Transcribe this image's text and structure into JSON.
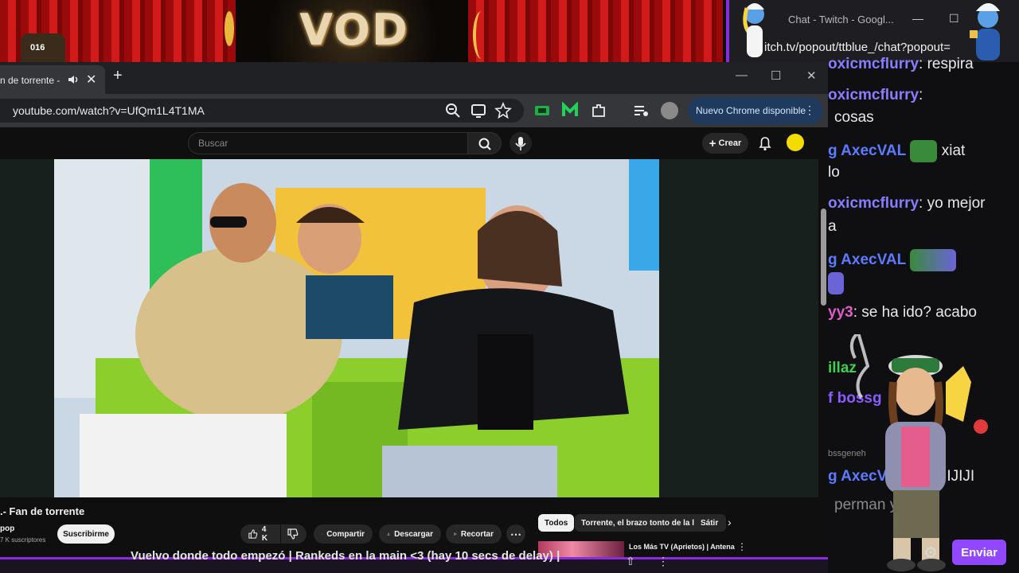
{
  "banner": {
    "title": "VOD",
    "counter": "016"
  },
  "chat_window": {
    "title": "Chat - Twitch - Googl...",
    "url": "itch.tv/popout/ttblue_/chat?popout=",
    "messages": [
      {
        "user": "oxicmcflurry",
        "text": ": respira",
        "color": "#8a7cff"
      },
      {
        "user": "oxicmcflurry",
        "text": ":",
        "color": "#8a7cff"
      },
      {
        "user": "",
        "text": "cosas",
        "color": "#e8e8ea"
      },
      {
        "user": "g AxecVAL",
        "text": "xiat",
        "color": "#5b7cff"
      },
      {
        "user": "",
        "text": "lo",
        "color": "#e8e8ea"
      },
      {
        "user": "oxicmcflurry",
        "text": ": yo mejor",
        "color": "#8a7cff"
      },
      {
        "user": "",
        "text": "a",
        "color": "#e8e8ea"
      },
      {
        "user": "g AxecVAL",
        "text": ":",
        "color": "#5b7cff"
      },
      {
        "user": "yy3",
        "text": ": se ha ido? acabo",
        "color": "#e05cc8"
      },
      {
        "user": "illaz",
        "text": "",
        "color": "#3fcf4a"
      },
      {
        "user": "f bossg",
        "text": "",
        "color": "#8a5cff"
      },
      {
        "user": "bssgeneh",
        "text": "",
        "color": "#888888"
      },
      {
        "user": "g AxecVA",
        "text": "JIJIJI",
        "color": "#5b7cff"
      }
    ],
    "input_text": "perman       y    ned",
    "send_label": "Enviar"
  },
  "browser": {
    "tab_title": "n de torrente -",
    "url": "youtube.com/watch?v=UfQm1L4T1MA",
    "update_label": "Nuevo Chrome disponible"
  },
  "youtube": {
    "search_placeholder": "Buscar",
    "create_label": "Crear",
    "video_title": ".- Fan de torrente",
    "channel": "pop",
    "subscribers": "7 K suscriptores",
    "subscribe_label": "Suscribirme",
    "likes": "4 K",
    "share_label": "Compartir",
    "download_label": "Descargar",
    "clip_label": "Recortar",
    "chips": [
      "Todos",
      "Torrente, el brazo tonto de la ley",
      "Sátir"
    ],
    "rec_title": "Los Más TV (Aprietos) | Antena"
  },
  "bottom_text": "Vuelvo donde todo empezó | Rankeds en la main <3 (hay 10 secs de delay) |",
  "colors": {
    "accent": "#9147ff",
    "chrome_update": "#1f3a5c"
  }
}
